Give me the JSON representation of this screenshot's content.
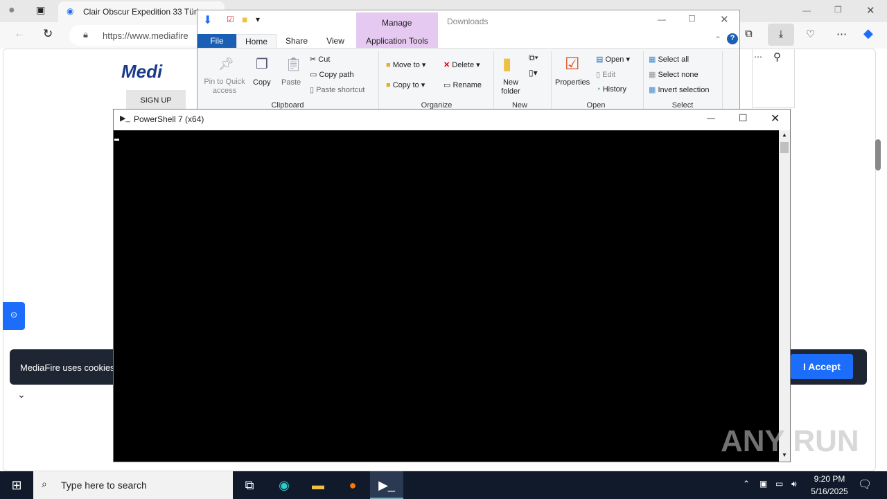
{
  "browser": {
    "tab_title": "Clair Obscur Expedition 33 Türk",
    "url": "https://www.mediafire"
  },
  "page": {
    "logo": "Medi",
    "signup": "SIGN UP",
    "cookie_text": "MediaFire uses cookies",
    "accept": "I Accept"
  },
  "explorer": {
    "title": "Downloads",
    "context_tab": "Manage",
    "tabs": [
      "File",
      "Home",
      "Share",
      "View",
      "Application Tools"
    ],
    "clipboard": {
      "pin": "Pin to Quick access",
      "copy": "Copy",
      "paste": "Paste",
      "cut": "Cut",
      "copy_path": "Copy path",
      "paste_shortcut": "Paste shortcut",
      "group": "Clipboard"
    },
    "organize": {
      "move_to": "Move to",
      "copy_to": "Copy to",
      "delete": "Delete",
      "rename": "Rename",
      "group": "Organize"
    },
    "new": {
      "new_folder": "New folder",
      "group": "New"
    },
    "open": {
      "properties": "Properties",
      "open": "Open",
      "edit": "Edit",
      "history": "History",
      "group": "Open"
    },
    "select": {
      "select_all": "Select all",
      "select_none": "Select none",
      "invert": "Invert selection",
      "group": "Select"
    }
  },
  "powershell": {
    "title": "PowerShell 7 (x64)"
  },
  "taskbar": {
    "search_placeholder": "Type here to search",
    "time": "9:20 PM",
    "date": "5/16/2025"
  },
  "watermark": "ANY RUN"
}
